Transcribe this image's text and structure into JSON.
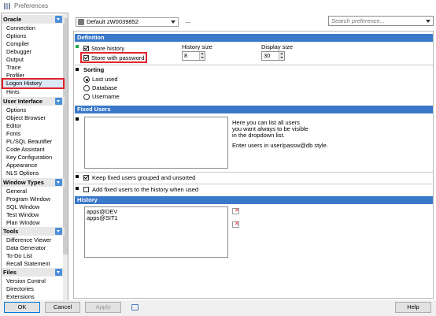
{
  "window": {
    "title": "Preferences"
  },
  "toolbar": {
    "profile": "Default zW0039852",
    "more_label": "...",
    "search_placeholder": "Search preference..."
  },
  "sidebar": {
    "categories": [
      {
        "title": "Oracle",
        "items": [
          "Connection",
          "Options",
          "Compiler",
          "Debugger",
          "Output",
          "Trace",
          "Profiler",
          "Logon History",
          "Hints"
        ]
      },
      {
        "title": "User Interface",
        "items": [
          "Options",
          "Object Browser",
          "Editor",
          "Fonts",
          "PL/SQL Beautifier",
          "Code Assistant",
          "Key Configuration",
          "Appearance",
          "NLS Options"
        ]
      },
      {
        "title": "Window Types",
        "items": [
          "General",
          "Program Window",
          "SQL Window",
          "Test Window",
          "Plan Window"
        ]
      },
      {
        "title": "Tools",
        "items": [
          "Difference Viewer",
          "Data Generator",
          "To-Do List",
          "Recall Statement"
        ]
      },
      {
        "title": "Files",
        "items": [
          "Version Control",
          "Directories",
          "Extensions"
        ]
      }
    ],
    "selected": "Logon History"
  },
  "definition": {
    "header": "Definition",
    "store_history": {
      "label": "Store history",
      "checked": true
    },
    "store_with_password": {
      "label": "Store with password",
      "checked": true
    },
    "history_size_label": "History size",
    "history_size": "8",
    "display_size_label": "Display size",
    "display_size": "30",
    "sorting_label": "Sorting",
    "sorting_options": [
      "Last used",
      "Database",
      "Username"
    ],
    "sorting_selected": "Last used"
  },
  "fixed_users": {
    "header": "Fixed Users",
    "help_line1": "Here you can list all users",
    "help_line2": "you want always to be visible",
    "help_line3": "in the dropdown list.",
    "help_line4": "Enter users in user/passw@db style.",
    "keep_grouped": {
      "label": "Keep fixed users grouped and unsorted",
      "checked": true
    },
    "add_to_history": {
      "label": "Add fixed users to the history when used",
      "checked": false
    }
  },
  "history": {
    "header": "History",
    "entries": [
      "apps@DEV",
      "apps@SIT1"
    ]
  },
  "buttons": {
    "ok": "OK",
    "cancel": "Cancel",
    "apply": "Apply",
    "help": "Help"
  },
  "colors": {
    "section_header": "#3a78c9",
    "highlight": "#e2242a",
    "selection": "#dbe8f7"
  }
}
